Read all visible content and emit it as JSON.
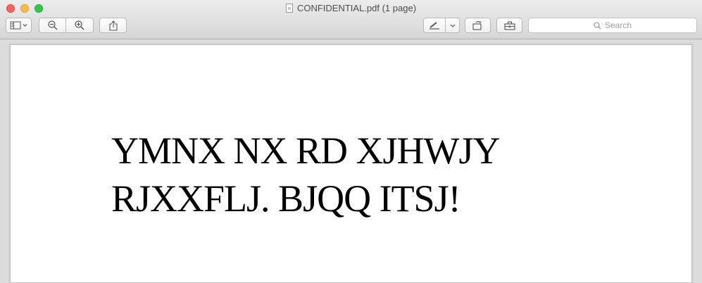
{
  "window": {
    "title": "CONFIDENTIAL.pdf (1 page)",
    "file_icon": "pdf-document-icon"
  },
  "toolbar": {
    "sidebar_button_icon": "sidebar-icon",
    "zoom_out_icon": "zoom-out-icon",
    "zoom_in_icon": "zoom-in-icon",
    "share_icon": "share-icon",
    "markup_icon": "markup-pen-icon",
    "rotate_icon": "rotate-icon",
    "toolbox_icon": "toolbox-icon"
  },
  "search": {
    "placeholder": "Search"
  },
  "document": {
    "lines": [
      "YMNX NX RD XJHWJY",
      "RJXXFLJ. BJQQ ITSJ!"
    ]
  }
}
